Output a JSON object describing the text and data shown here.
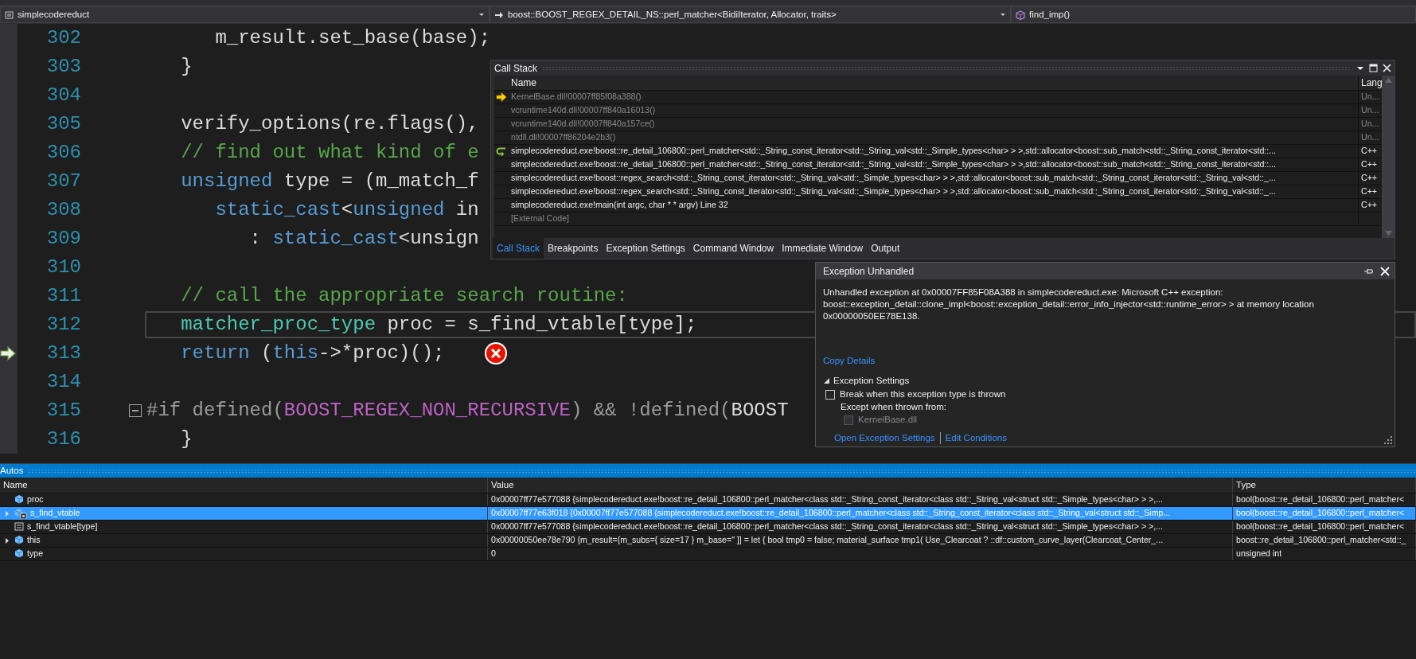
{
  "nav_bar": {
    "project": "simplecodereduct",
    "scope": "boost::BOOST_REGEX_DETAIL_NS::perl_matcher<BidiIterator, Allocator, traits>",
    "member": "find_imp()"
  },
  "editor": {
    "lines": [
      {
        "number": "302",
        "tokens": [
          {
            "kind": "plain",
            "text": "      m_result.set_base(base);"
          }
        ],
        "highlighted": false,
        "current_statement": false,
        "error": false,
        "fold_button": false
      },
      {
        "number": "303",
        "tokens": [
          {
            "kind": "plain",
            "text": "   }"
          }
        ],
        "highlighted": false,
        "current_statement": false,
        "error": false,
        "fold_button": false
      },
      {
        "number": "304",
        "highlighted": false,
        "current_statement": false,
        "error": false,
        "fold_button": false
      },
      {
        "number": "305",
        "tokens": [
          {
            "kind": "plain",
            "text": "   verify_options(re.flags(),"
          }
        ],
        "highlighted": false,
        "current_statement": false,
        "error": false,
        "fold_button": false
      },
      {
        "number": "306",
        "tokens": [
          {
            "kind": "comment",
            "text": "   // find out what kind of e"
          }
        ],
        "highlighted": false,
        "current_statement": false,
        "error": false,
        "fold_button": false
      },
      {
        "number": "307",
        "tokens": [
          {
            "kind": "keyword",
            "text": "   unsigned"
          },
          {
            "kind": "plain",
            "text": " type = (m_match_f"
          }
        ],
        "highlighted": false,
        "current_statement": false,
        "error": false,
        "fold_button": false
      },
      {
        "number": "308",
        "tokens": [
          {
            "kind": "keyword",
            "text": "      static_cast"
          },
          {
            "kind": "plain",
            "text": "<"
          },
          {
            "kind": "keyword",
            "text": "unsigned"
          },
          {
            "kind": "plain",
            "text": " in"
          }
        ],
        "highlighted": false,
        "current_statement": false,
        "error": false,
        "fold_button": false
      },
      {
        "number": "309",
        "tokens": [
          {
            "kind": "plain",
            "text": "         : "
          },
          {
            "kind": "keyword",
            "text": "static_cast"
          },
          {
            "kind": "plain",
            "text": "<unsign"
          }
        ],
        "highlighted": false,
        "current_statement": false,
        "error": false,
        "fold_button": false
      },
      {
        "number": "310",
        "highlighted": false,
        "current_statement": false,
        "error": false,
        "fold_button": false
      },
      {
        "number": "311",
        "tokens": [
          {
            "kind": "comment",
            "text": "   // call the appropriate search routine:"
          }
        ],
        "highlighted": false,
        "current_statement": false,
        "error": false,
        "fold_button": false
      },
      {
        "number": "312",
        "tokens": [
          {
            "kind": "type",
            "text": "   matcher_proc_type"
          },
          {
            "kind": "plain",
            "text": " proc = s_find_vtable[type];"
          }
        ],
        "highlighted": true,
        "current_statement": false,
        "error": false,
        "fold_button": false
      },
      {
        "number": "313",
        "tokens": [
          {
            "kind": "keyword",
            "text": "   return"
          },
          {
            "kind": "plain",
            "text": " ("
          },
          {
            "kind": "keyword",
            "text": "this"
          },
          {
            "kind": "plain",
            "text": "->*proc)();"
          }
        ],
        "highlighted": false,
        "current_statement": true,
        "error": true,
        "fold_button": false
      },
      {
        "number": "314",
        "highlighted": false,
        "current_statement": false,
        "error": false,
        "fold_button": false
      },
      {
        "number": "315",
        "tokens": [
          {
            "kind": "preprocessor",
            "text": "#if defined("
          },
          {
            "kind": "macro",
            "text": "BOOST_REGEX_NON_RECURSIVE"
          },
          {
            "kind": "preprocessor",
            "text": ") && !defined("
          },
          {
            "kind": "plain",
            "text": "BOOST"
          }
        ],
        "highlighted": false,
        "current_statement": false,
        "error": false,
        "fold_button": true
      },
      {
        "number": "316",
        "tokens": [
          {
            "kind": "plain",
            "text": "   }"
          }
        ],
        "highlighted": false,
        "current_statement": false,
        "error": false,
        "fold_button": false
      }
    ]
  },
  "call_stack": {
    "title": "Call Stack",
    "columns": [
      "Name",
      "Lang"
    ],
    "rows": [
      {
        "name": "KernelBase.dll!00007ff85f08a388()",
        "lang": "Un...",
        "external": true,
        "current": true,
        "return_point": false
      },
      {
        "name": "vcruntime140d.dll!00007ff840a16013()",
        "lang": "Un...",
        "external": true,
        "current": false,
        "return_point": false
      },
      {
        "name": "vcruntime140d.dll!00007ff840a157ce()",
        "lang": "Un...",
        "external": true,
        "current": false,
        "return_point": false
      },
      {
        "name": "ntdll.dll!00007ff86204e2b3()",
        "lang": "Un...",
        "external": true,
        "current": false,
        "return_point": false
      },
      {
        "name": "simplecodereduct.exe!boost::re_detail_106800::perl_matcher<std::_String_const_iterator<std::_String_val<std::_Simple_types<char> > >,std::allocator<boost::sub_match<std::_String_const_iterator<std::...",
        "lang": "C++",
        "external": false,
        "current": false,
        "return_point": true
      },
      {
        "name": "simplecodereduct.exe!boost::re_detail_106800::perl_matcher<std::_String_const_iterator<std::_String_val<std::_Simple_types<char> > >,std::allocator<boost::sub_match<std::_String_const_iterator<std::...",
        "lang": "C++",
        "external": false,
        "current": false,
        "return_point": false
      },
      {
        "name": "simplecodereduct.exe!boost::regex_search<std::_String_const_iterator<std::_String_val<std::_Simple_types<char> > >,std::allocator<boost::sub_match<std::_String_const_iterator<std::_String_val<std::_...",
        "lang": "C++",
        "external": false,
        "current": false,
        "return_point": false
      },
      {
        "name": "simplecodereduct.exe!boost::regex_search<std::_String_const_iterator<std::_String_val<std::_Simple_types<char> > >,std::allocator<boost::sub_match<std::_String_const_iterator<std::_String_val<std::_...",
        "lang": "C++",
        "external": false,
        "current": false,
        "return_point": false
      },
      {
        "name": "simplecodereduct.exe!main(int argc, char * * argv) Line 32",
        "lang": "C++",
        "external": false,
        "current": false,
        "return_point": false
      },
      {
        "name": "[External Code]",
        "external": true,
        "current": false,
        "return_point": false
      }
    ],
    "tabs": [
      {
        "label": "Call Stack",
        "selected": true
      },
      {
        "label": "Breakpoints",
        "selected": false
      },
      {
        "label": "Exception Settings",
        "selected": false
      },
      {
        "label": "Command Window",
        "selected": false
      },
      {
        "label": "Immediate Window",
        "selected": false
      },
      {
        "label": "Output",
        "selected": false
      }
    ]
  },
  "exception": {
    "title": "Exception Unhandled",
    "message": "Unhandled exception at 0x00007FF85F08A388 in simplecodereduct.exe: Microsoft C++ exception: boost::exception_detail::clone_impl<boost::exception_detail::error_info_injector<std::runtime_error> > at memory location 0x00000050EE78E138.",
    "copy_link": "Copy Details",
    "settings": {
      "label": "Exception Settings",
      "expanded": true,
      "break_option": {
        "label": "Break when this exception type is thrown",
        "checked": false
      },
      "except_label": "Except when thrown from:",
      "except_option": {
        "label": "KernelBase.dll",
        "checked": false,
        "disabled": true
      }
    },
    "links": [
      "Open Exception Settings",
      "Edit Conditions"
    ]
  },
  "autos": {
    "title": "Autos",
    "columns": [
      "Name",
      "Value",
      "Type"
    ],
    "rows": [
      {
        "kind": "variable",
        "name": "proc",
        "value": "0x00007ff77e577088 {simplecodereduct.exe!boost::re_detail_106800::perl_matcher<class std::_String_const_iterator<class std::_String_val<struct std::_Simple_types<char> > >,...",
        "type": "bool(boost::re_detail_106800::perl_matcher<",
        "selected": false,
        "expandable": false
      },
      {
        "kind": "static",
        "name": "s_find_vtable",
        "value": "0x00007ff77e63f018 {0x00007ff77e577088 {simplecodereduct.exe!boost::re_detail_106800::perl_matcher<class std::_String_const_iterator<class std::_String_val<struct std::_Simp...",
        "type": "bool(boost::re_detail_106800::perl_matcher<",
        "selected": true,
        "expandable": true,
        "expanded": false
      },
      {
        "kind": "element",
        "name": "s_find_vtable[type]",
        "value": "0x00007ff77e577088 {simplecodereduct.exe!boost::re_detail_106800::perl_matcher<class std::_String_const_iterator<class std::_String_val<struct std::_Simple_types<char> > >,...",
        "type": "bool(boost::re_detail_106800::perl_matcher<",
        "selected": false,
        "expandable": false
      },
      {
        "kind": "variable",
        "name": "this",
        "value": "0x00000050ee78e790 {m_result={m_subs={ size=17 } m_base=\" ]] = let { bool tmp0 = false; material_surface tmp1( Use_Clearcoat ? ::df::custom_curve_layer(Clearcoat_Center_...",
        "type": "boost::re_detail_106800::perl_matcher<std::_",
        "selected": false,
        "expandable": true,
        "expanded": false
      },
      {
        "kind": "variable",
        "name": "type",
        "value": "0",
        "type": "unsigned int",
        "selected": false,
        "expandable": false
      }
    ]
  }
}
